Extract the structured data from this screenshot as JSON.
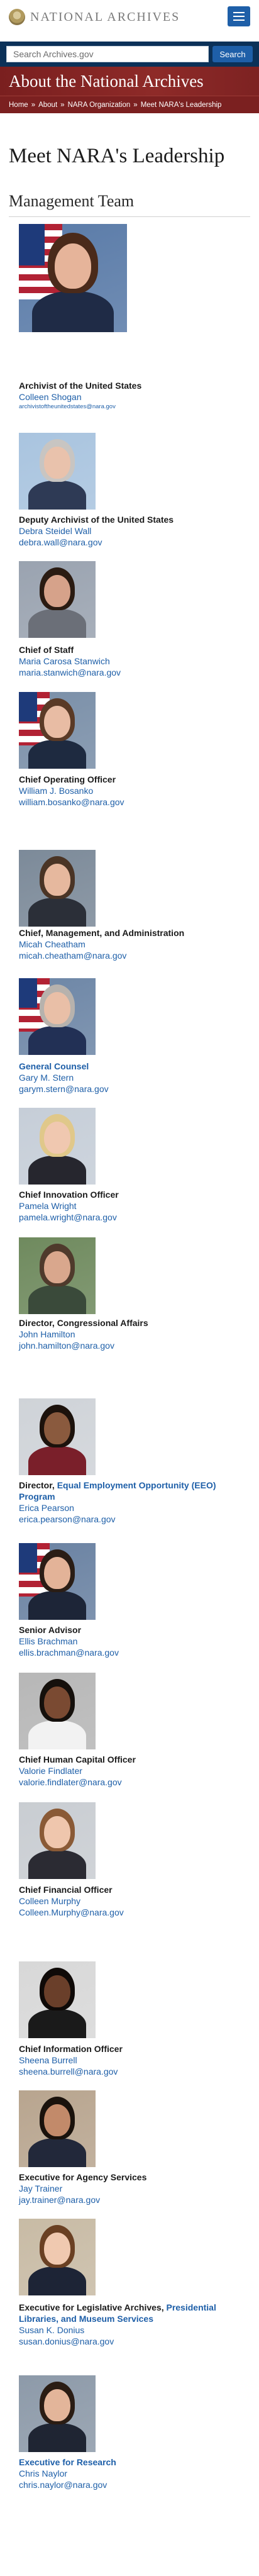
{
  "header": {
    "logo_text": "NATIONAL ARCHIVES",
    "menu_icon": "hamburger-menu-icon",
    "search_placeholder": "Search Archives.gov",
    "search_button": "Search"
  },
  "banner": {
    "title": "About the National Archives",
    "breadcrumbs": [
      "Home",
      "About",
      "NARA Organization",
      "Meet NARA's Leadership"
    ],
    "separator": "»"
  },
  "page_title": "Meet NARA's Leadership",
  "section_title": "Management Team",
  "colors": {
    "link": "#1e5fa8",
    "banner": "#7b2020",
    "search_bar": "#0b3158"
  },
  "staff": [
    {
      "role": "Archivist of the United States",
      "name": "Colleen Shogan",
      "email": "archivistoftheunitedstates@nara.gov"
    },
    {
      "role": "Deputy Archivist of the United States",
      "name": "Debra Steidel Wall",
      "email": "debra.wall@nara.gov"
    },
    {
      "role": "Chief of Staff",
      "name": "Maria Carosa Stanwich",
      "email": "maria.stanwich@nara.gov"
    },
    {
      "role": "Chief Operating Officer",
      "name": "William J. Bosanko",
      "email": "william.bosanko@nara.gov"
    },
    {
      "role": "Chief, Management, and Administration",
      "name": "Micah Cheatham",
      "email": "micah.cheatham@nara.gov"
    },
    {
      "role": "General Counsel",
      "name": "Gary M. Stern",
      "email": "garym.stern@nara.gov"
    },
    {
      "role": "Chief Innovation Officer",
      "name": "Pamela Wright",
      "email": "pamela.wright@nara.gov"
    },
    {
      "role": "Director, Congressional Affairs",
      "name": "John Hamilton",
      "email": "john.hamilton@nara.gov"
    },
    {
      "role_prefix": "Director, ",
      "role_link": "Equal Employment Opportunity (EEO) Program",
      "name": "Erica Pearson",
      "email": "erica.pearson@nara.gov"
    },
    {
      "role": "Senior Advisor",
      "name": "Ellis Brachman",
      "email": "ellis.brachman@nara.gov"
    },
    {
      "role": "Chief Human Capital Officer",
      "name": "Valorie Findlater",
      "email": "valorie.findlater@nara.gov"
    },
    {
      "role": "Chief Financial Officer",
      "name": "Colleen Murphy",
      "email": "Colleen.Murphy@nara.gov"
    },
    {
      "role": "Chief Information Officer",
      "name": "Sheena Burrell",
      "email": "sheena.burrell@nara.gov"
    },
    {
      "role": "Executive for Agency Services",
      "name": "Jay Trainer",
      "email": "jay.trainer@nara.gov"
    },
    {
      "role_prefix": "Executive for Legislative Archives, ",
      "role_link": "Presidential Libraries, and Museum Services",
      "name": "Susan K. Donius",
      "email": "susan.donius@nara.gov"
    },
    {
      "role": "Executive for Research",
      "name": "Chris Naylor",
      "email": "chris.naylor@nara.gov"
    }
  ]
}
